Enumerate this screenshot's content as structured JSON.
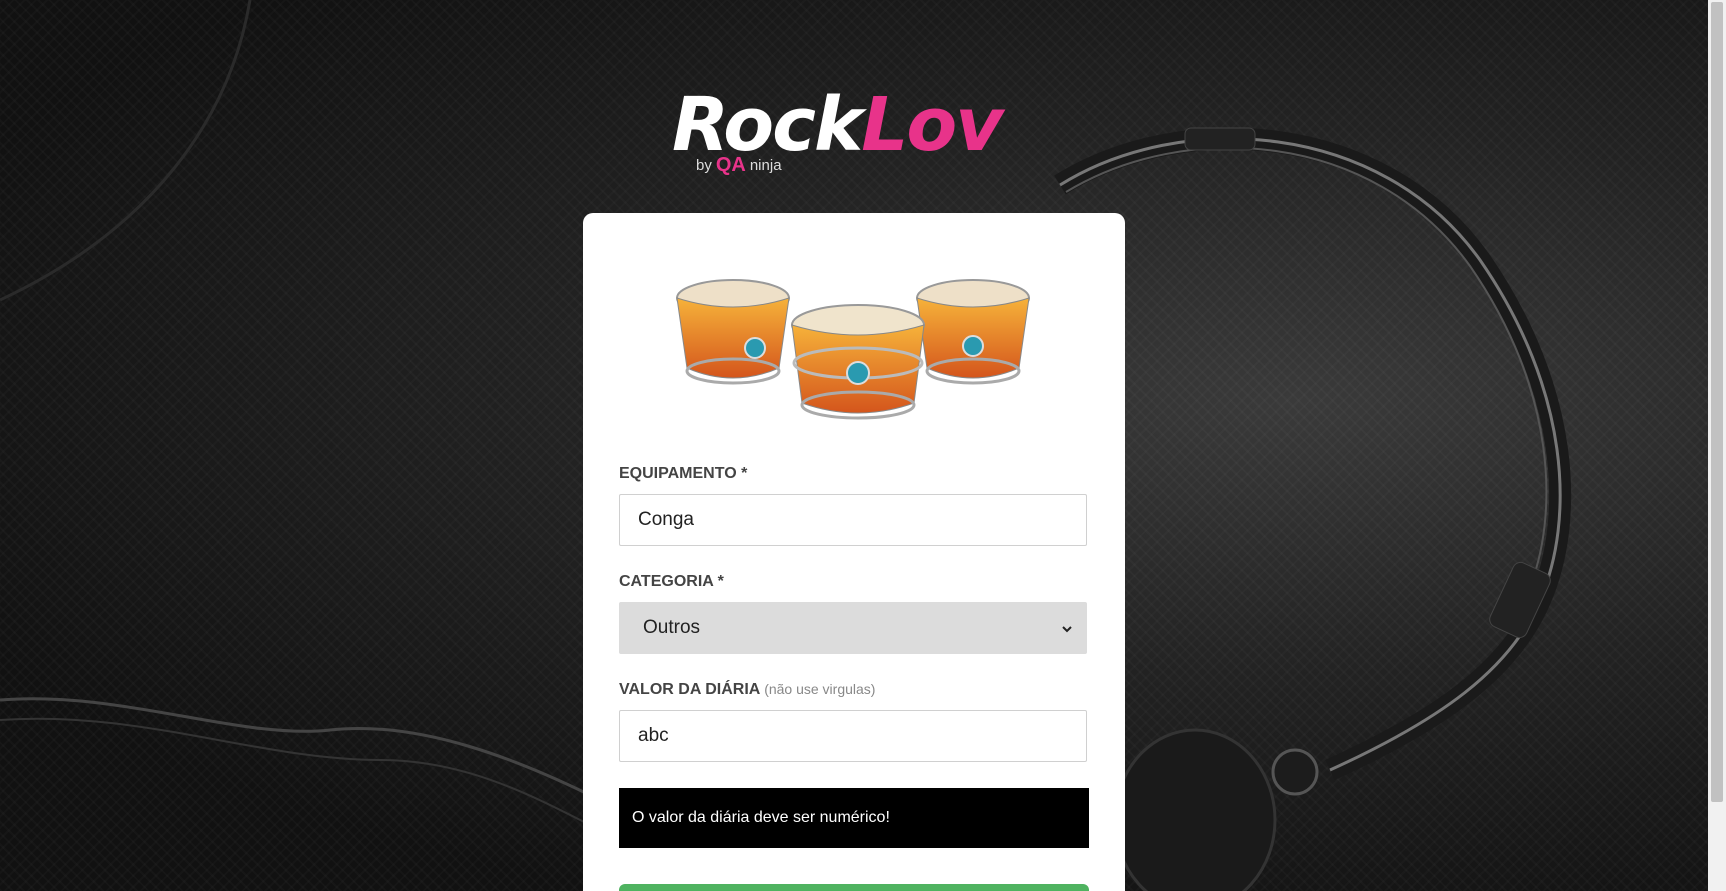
{
  "brand": {
    "name_part1": "Rock",
    "name_part2": "Lov",
    "by": "by",
    "qa": "QA",
    "ninja": "ninja"
  },
  "form": {
    "equipment_label": "EQUIPAMENTO *",
    "equipment_value": "Conga",
    "category_label": "CATEGORIA *",
    "category_value": "Outros",
    "price_label": "VALOR DA DIÁRIA",
    "price_hint": "(não use virgulas)",
    "price_value": "abc",
    "error_message": "O valor da diária deve ser numérico!"
  },
  "colors": {
    "accent_pink": "#e8338a",
    "submit_green": "#4fb360"
  }
}
